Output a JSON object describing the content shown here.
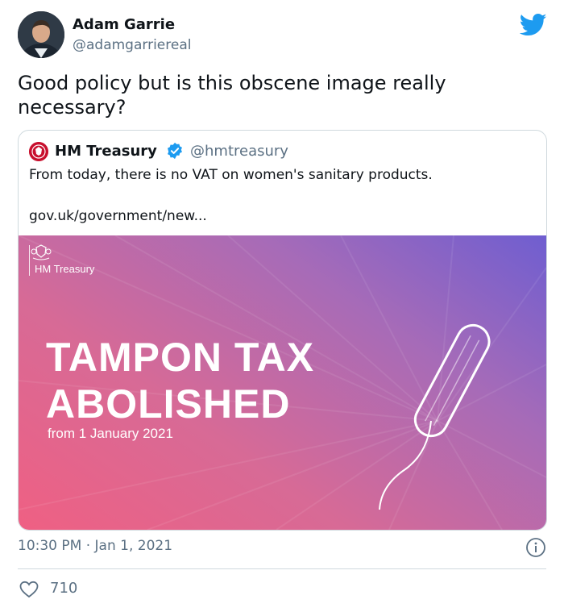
{
  "author": {
    "name": "Adam Garrie",
    "handle": "@adamgarriereal"
  },
  "tweet": {
    "text": "Good policy but is this obscene image really necessary?",
    "timestamp": "10:30 PM · Jan 1, 2021",
    "likes": "710"
  },
  "quoted": {
    "name": "HM Treasury",
    "handle": "@hmtreasury",
    "verified": true,
    "text": "From today, there is no VAT on women's sanitary products.",
    "link": "gov.uk/government/new...",
    "image": {
      "brand": "HM Treasury",
      "headline_line1": "TAMPON TAX",
      "headline_line2": "ABOLISHED",
      "subline": "from 1 January 2021"
    }
  },
  "colors": {
    "twitter_blue": "#1d9bf0",
    "secondary_text": "#5b7083",
    "gradient_start": "#ef6083",
    "gradient_end": "#6f5ed0"
  },
  "icons": [
    "twitter-logo-icon",
    "verified-badge-icon",
    "info-icon",
    "heart-icon"
  ]
}
